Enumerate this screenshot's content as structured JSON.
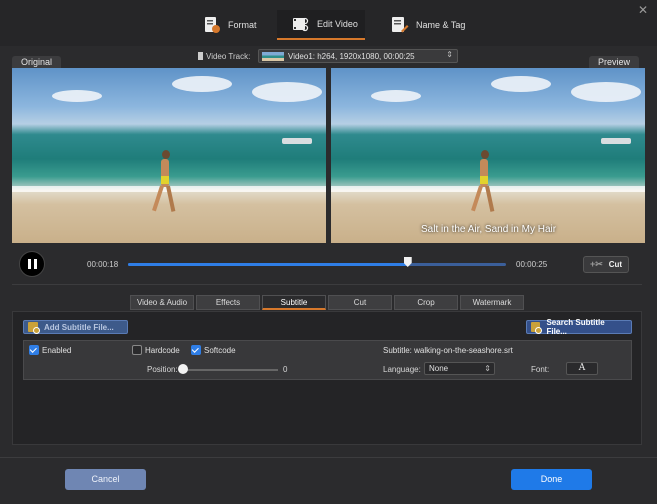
{
  "tabs": [
    {
      "label": "Format",
      "icon": "format-icon"
    },
    {
      "label": "Edit Video",
      "icon": "edit-video-icon",
      "active": true
    },
    {
      "label": "Name & Tag",
      "icon": "name-tag-icon"
    }
  ],
  "track": {
    "label": "Video Track:",
    "value": "Video1: h264, 1920x1080, 00:00:25"
  },
  "panes": {
    "original": "Original",
    "preview": "Preview"
  },
  "preview_subtitle": "Salt in the Air, Sand in My Hair",
  "playback": {
    "current_time": "00:00:18",
    "total_time": "00:00:25",
    "progress": 0.74,
    "cut_label": "Cut"
  },
  "subtabs": [
    "Video & Audio",
    "Effects",
    "Subtitle",
    "Cut",
    "Crop",
    "Watermark"
  ],
  "active_subtab": "Subtitle",
  "subtitle": {
    "add_label": "Add Subtitle File...",
    "search_label": "Search Subtitle File...",
    "enabled_label": "Enabled",
    "enabled": true,
    "hardcode_label": "Hardcode",
    "hardcode": false,
    "softcode_label": "Softcode",
    "softcode": true,
    "file_text": "Subtitle: walking-on-the-seashore.srt",
    "position_label": "Position:",
    "position_value": "0",
    "language_label": "Language:",
    "language_value": "None",
    "font_label": "Font:",
    "font_glyph": "A"
  },
  "footer": {
    "cancel": "Cancel",
    "done": "Done"
  },
  "colors": {
    "accent": "#d6782b",
    "primary": "#1f7ae8"
  }
}
